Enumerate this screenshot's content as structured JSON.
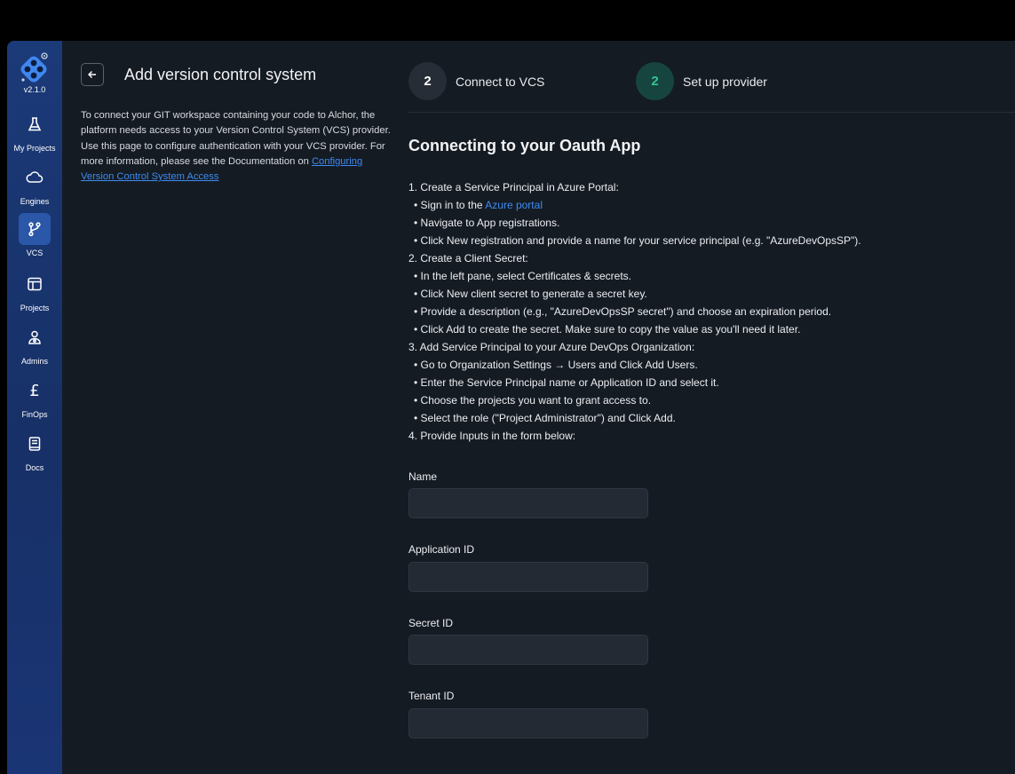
{
  "sidebar": {
    "version": "v2.1.0",
    "items": [
      {
        "label": "My Projects",
        "icon": "flask-icon"
      },
      {
        "label": "Engines",
        "icon": "cloud-icon"
      },
      {
        "label": "VCS",
        "icon": "git-branch-icon"
      },
      {
        "label": "Projects",
        "icon": "layout-icon"
      },
      {
        "label": "Admins",
        "icon": "user-admin-icon"
      },
      {
        "label": "FinOps",
        "icon": "pound-icon"
      },
      {
        "label": "Docs",
        "icon": "book-icon"
      }
    ],
    "active": "VCS"
  },
  "header": {
    "title": "Add version control system"
  },
  "description": {
    "text": "To connect your GIT workspace containing your code to Alchor, the platform needs access to your Version Control System (VCS) provider. Use this page to configure authentication with your VCS provider. For more information, please see the Documentation on",
    "link": "Configuring Version Control System Access"
  },
  "steps": [
    {
      "number": "2",
      "label": "Connect to VCS"
    },
    {
      "number": "2",
      "label": "Set  up provider"
    }
  ],
  "content": {
    "heading": "Connecting to your Oauth App",
    "lines": [
      {
        "bullet": false,
        "text": "1. Create a Service Principal in Azure Portal:"
      },
      {
        "bullet": true,
        "text": "Sign in to the ",
        "link": "Azure portal"
      },
      {
        "bullet": true,
        "text": "Navigate to App registrations."
      },
      {
        "bullet": true,
        "text": " Click New registration and provide a name for your service principal (e.g. \"AzureDevOpsSP\")."
      },
      {
        "bullet": false,
        "text": "2. Create a Client Secret:"
      },
      {
        "bullet": true,
        "text": " In the left pane, select Certificates & secrets."
      },
      {
        "bullet": true,
        "text": " Click New client secret to generate a secret key."
      },
      {
        "bullet": true,
        "text": "Provide a description (e.g., \"AzureDevOpsSP secret\") and choose an expiration period."
      },
      {
        "bullet": true,
        "text": " Click Add to create the secret. Make sure to copy the value as you'll need it later."
      },
      {
        "bullet": false,
        "text": "3. Add Service Principal to your Azure DevOps Organization:"
      },
      {
        "bullet": true,
        "text": " Go to Organization Settings → Users and Click Add Users."
      },
      {
        "bullet": true,
        "text": " Enter the Service Principal name or Application ID and select it."
      },
      {
        "bullet": true,
        "text": "Choose the projects you want to grant access to."
      },
      {
        "bullet": true,
        "text": "Select the role (\"Project Administrator\") and Click Add."
      },
      {
        "bullet": false,
        "text": "4. Provide Inputs in the form below:"
      }
    ]
  },
  "form": {
    "fields": [
      {
        "label": "Name",
        "value": ""
      },
      {
        "label": "Application ID",
        "value": ""
      },
      {
        "label": "Secret ID",
        "value": ""
      },
      {
        "label": "Tenant ID",
        "value": ""
      }
    ]
  },
  "colors": {
    "accent": "#3d8bf2",
    "step1_bg": "#262d36",
    "step2_bg": "#16453f",
    "step2_text": "#35c48f",
    "sidebar": "#1b3a78"
  }
}
